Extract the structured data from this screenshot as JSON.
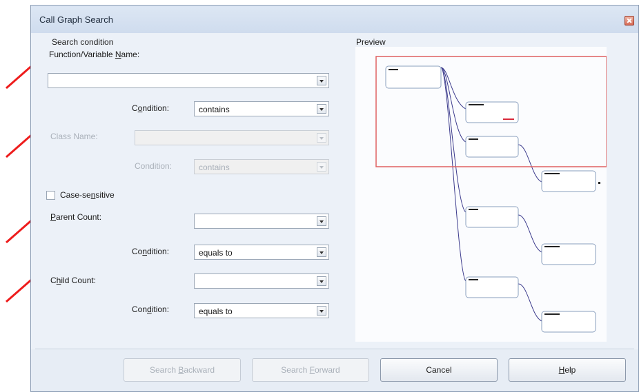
{
  "window": {
    "title": "Call Graph Search"
  },
  "search_condition": {
    "group_label": "Search condition",
    "function_name": {
      "label_pre": "Function/Variable ",
      "label_key": "N",
      "label_post": "ame:",
      "value": ""
    },
    "function_condition": {
      "label_pre": "C",
      "label_key": "o",
      "label_post": "ndition:",
      "value": "contains"
    },
    "class_name": {
      "label": "Class Name:",
      "value": ""
    },
    "class_condition": {
      "label": "Condition:",
      "value": "contains"
    },
    "case_sensitive": {
      "label_pre": "Case-se",
      "label_key": "n",
      "label_post": "sitive",
      "checked": false
    },
    "parent_count": {
      "label_pre": "",
      "label_key": "P",
      "label_post": "arent Count:",
      "value": ""
    },
    "parent_condition": {
      "label_pre": "Co",
      "label_key": "n",
      "label_post": "dition:",
      "value": "equals to"
    },
    "child_count": {
      "label_pre": "C",
      "label_key": "h",
      "label_post": "ild Count:",
      "value": ""
    },
    "child_condition": {
      "label_pre": "Con",
      "label_key": "d",
      "label_post": "ition:",
      "value": "equals to"
    }
  },
  "preview": {
    "label": "Preview"
  },
  "buttons": {
    "search_backward": {
      "pre": "Search ",
      "key": "B",
      "post": "ackward"
    },
    "search_forward": {
      "pre": "Search ",
      "key": "F",
      "post": "orward"
    },
    "cancel": "Cancel",
    "help": {
      "pre": "",
      "key": "H",
      "post": "elp"
    }
  },
  "colors": {
    "annotation_arrow": "#ee1c1c",
    "preview_highlight": "#e06060",
    "edge": "#3b3a8c"
  }
}
